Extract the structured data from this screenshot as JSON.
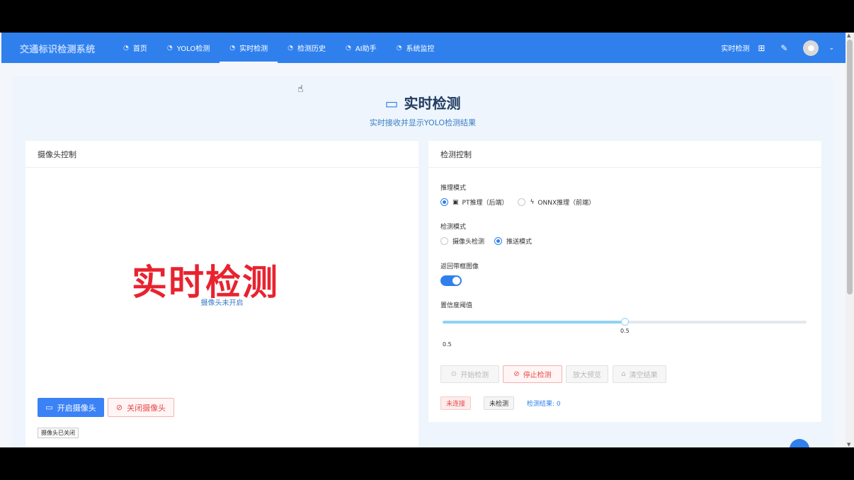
{
  "app": {
    "brand": "交通标识检测系统"
  },
  "nav": {
    "items": [
      {
        "icon": "dashboard-icon",
        "label": "首页"
      },
      {
        "icon": "dashboard-icon",
        "label": "YOLO检测"
      },
      {
        "icon": "dashboard-icon",
        "label": "实时检测"
      },
      {
        "icon": "dashboard-icon",
        "label": "检测历史"
      },
      {
        "icon": "dashboard-icon",
        "label": "AI助手"
      },
      {
        "icon": "dashboard-icon",
        "label": "系统监控"
      }
    ],
    "active_index": 2,
    "right_title": "实时检测"
  },
  "hero": {
    "title": "实时检测",
    "subtitle": "实时接收并显示YOLO检测结果"
  },
  "camera_card": {
    "title": "摄像头控制",
    "placeholder": "摄像头未开启",
    "watermark": "实时检测",
    "open_button": "开启摄像头",
    "close_button": "关闭摄像头",
    "status": "摄像头已关闭"
  },
  "detect_card": {
    "title": "检测控制",
    "inference_label": "推理模式",
    "inference_options": [
      {
        "label": "PT推理（后端）",
        "selected": true
      },
      {
        "label": "ONNX推理（前端）",
        "selected": false
      }
    ],
    "mode_label": "检测模式",
    "mode_options": [
      {
        "label": "摄像头检测",
        "selected": false
      },
      {
        "label": "推送模式",
        "selected": true
      }
    ],
    "return_box_label": "返回带框图像",
    "return_box_enabled": true,
    "confidence_label": "置信度阈值",
    "confidence_value": 0.5,
    "confidence_tip": "0.5",
    "confidence_text": "0.5",
    "buttons": {
      "start": "开始检测",
      "stop": "停止检测",
      "zoom": "放大预览",
      "clear": "清空结果"
    },
    "status_disconnected": "未连接",
    "status_not_detecting": "未检测",
    "result_count": "检测结果: 0"
  },
  "colors": {
    "primary": "#2f80ed",
    "danger": "#e54848",
    "watermark": "#e8232f"
  }
}
